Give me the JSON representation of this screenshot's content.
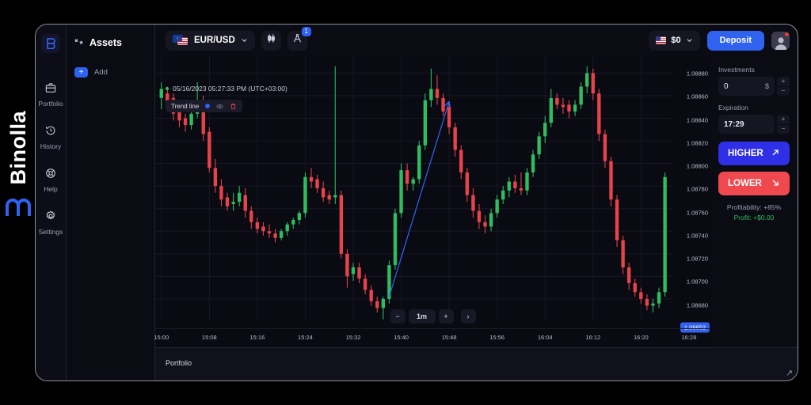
{
  "brand": {
    "name": "Binolla",
    "logo_icon": "binolla-m-logo"
  },
  "rail": {
    "logo_icon": "binolla-b-logo",
    "items": [
      {
        "label": "Portfolio",
        "icon": "briefcase-icon"
      },
      {
        "label": "History",
        "icon": "clock-history-icon"
      },
      {
        "label": "Help",
        "icon": "lifebuoy-icon"
      },
      {
        "label": "Settings",
        "icon": "gear-icon"
      }
    ]
  },
  "assets": {
    "title": "Assets",
    "title_icon": "assets-spark-icon",
    "add_label": "Add",
    "add_icon": "plus-icon"
  },
  "topbar": {
    "pair": "EUR/USD",
    "pair_chevron_icon": "chevron-down-icon",
    "flag_left_icon": "flag-eu-icon",
    "flag_right_icon": "flag-us-icon",
    "chart_type_icon": "candlestick-icon",
    "draw_tools_icon": "drawing-compass-icon",
    "draw_tools_badge": "1",
    "balance_flag_icon": "flag-us-icon",
    "balance": "$0",
    "balance_chevron_icon": "chevron-down-icon",
    "deposit_label": "Deposit",
    "avatar_icon": "user-avatar-icon"
  },
  "chart_info": {
    "timestamp": "05/16/2023 05:27:33 PM (UTC+03:00)",
    "tool_name": "Trend line",
    "tool_color": "#2f62ef",
    "eye_icon": "eye-icon",
    "trash_icon": "trash-icon"
  },
  "timeframe": {
    "minus_label": "−",
    "value": "1m",
    "plus_label": "+",
    "next_icon": "chevron-right-icon"
  },
  "trade": {
    "investments_label": "Investments",
    "investments_value": "0",
    "investments_unit": "$",
    "expiration_label": "Expiration",
    "expiration_value": "17:29",
    "step_up": "+",
    "step_down": "−",
    "higher_label": "HIGHER",
    "higher_icon": "arrow-up-right-icon",
    "lower_label": "LOWER",
    "lower_icon": "arrow-down-right-icon",
    "profitability": "Profitability: +85%",
    "profit": "Profit: +$0.00"
  },
  "bottombar": {
    "label": "Portfolio"
  },
  "colors": {
    "accent_blue": "#2f62ef",
    "higher_blue": "#2f2fe8",
    "lower_red": "#f0484f",
    "candle_up": "#2ebd60",
    "candle_down": "#e8424a",
    "background": "#0a0a12",
    "profit_green": "#2ebd60"
  },
  "chart_data": {
    "type": "candlestick",
    "title": "EUR/USD 1m",
    "xlabel": "",
    "ylabel": "",
    "ylim": [
      1.0866,
      1.08895
    ],
    "yticks": [
      "1.08880",
      "1.08860",
      "1.08840",
      "1.08820",
      "1.08800",
      "1.08780",
      "1.08760",
      "1.08740",
      "1.08720",
      "1.08700",
      "1.08680"
    ],
    "ytick_values": [
      1.0888,
      1.0886,
      1.0884,
      1.0882,
      1.088,
      1.0878,
      1.0876,
      1.0874,
      1.0872,
      1.087,
      1.0868
    ],
    "xticks": [
      "15:00",
      "15:08",
      "15:16",
      "15:24",
      "15:32",
      "15:40",
      "15:48",
      "15:56",
      "16:04",
      "16:12",
      "16:20",
      "16:28"
    ],
    "current_price": "1.08652",
    "grid": true,
    "legend": "none",
    "annotations": [
      {
        "type": "trendline",
        "label": "Trend line",
        "color": "#2f62ef",
        "from": {
          "time": "15:38",
          "price": 1.08682
        },
        "to": {
          "time": "15:48",
          "price": 1.08855
        },
        "arrow": true
      }
    ],
    "candles": [
      {
        "t": "15:00",
        "o": 1.08858,
        "h": 1.08872,
        "l": 1.08848,
        "c": 1.08866
      },
      {
        "t": "15:01",
        "o": 1.08862,
        "h": 1.08868,
        "l": 1.08852,
        "c": 1.08855
      },
      {
        "t": "15:02",
        "o": 1.08858,
        "h": 1.08862,
        "l": 1.08838,
        "c": 1.08844
      },
      {
        "t": "15:03",
        "o": 1.08846,
        "h": 1.0885,
        "l": 1.08832,
        "c": 1.08838
      },
      {
        "t": "15:04",
        "o": 1.0884,
        "h": 1.08844,
        "l": 1.08828,
        "c": 1.08834
      },
      {
        "t": "15:05",
        "o": 1.08834,
        "h": 1.08846,
        "l": 1.0883,
        "c": 1.08844
      },
      {
        "t": "15:06",
        "o": 1.08844,
        "h": 1.08872,
        "l": 1.0884,
        "c": 1.08856
      },
      {
        "t": "15:07",
        "o": 1.08856,
        "h": 1.0886,
        "l": 1.0882,
        "c": 1.08826
      },
      {
        "t": "15:08",
        "o": 1.08828,
        "h": 1.08832,
        "l": 1.08792,
        "c": 1.08796
      },
      {
        "t": "15:09",
        "o": 1.08796,
        "h": 1.08804,
        "l": 1.08774,
        "c": 1.0878
      },
      {
        "t": "15:10",
        "o": 1.0878,
        "h": 1.08786,
        "l": 1.08762,
        "c": 1.08768
      },
      {
        "t": "15:11",
        "o": 1.0877,
        "h": 1.08774,
        "l": 1.08758,
        "c": 1.08762
      },
      {
        "t": "15:12",
        "o": 1.08764,
        "h": 1.08774,
        "l": 1.08758,
        "c": 1.08766
      },
      {
        "t": "15:13",
        "o": 1.08766,
        "h": 1.0878,
        "l": 1.08762,
        "c": 1.08774
      },
      {
        "t": "15:14",
        "o": 1.08772,
        "h": 1.08778,
        "l": 1.08752,
        "c": 1.08758
      },
      {
        "t": "15:15",
        "o": 1.08758,
        "h": 1.08762,
        "l": 1.08742,
        "c": 1.08748
      },
      {
        "t": "15:16",
        "o": 1.08748,
        "h": 1.08752,
        "l": 1.08738,
        "c": 1.08742
      },
      {
        "t": "15:17",
        "o": 1.08744,
        "h": 1.08748,
        "l": 1.08736,
        "c": 1.0874
      },
      {
        "t": "15:18",
        "o": 1.0874,
        "h": 1.08746,
        "l": 1.08734,
        "c": 1.08738
      },
      {
        "t": "15:19",
        "o": 1.08738,
        "h": 1.08742,
        "l": 1.0873,
        "c": 1.08734
      },
      {
        "t": "15:20",
        "o": 1.08734,
        "h": 1.08742,
        "l": 1.08732,
        "c": 1.0874
      },
      {
        "t": "15:21",
        "o": 1.0874,
        "h": 1.08748,
        "l": 1.08736,
        "c": 1.08746
      },
      {
        "t": "15:22",
        "o": 1.08746,
        "h": 1.08752,
        "l": 1.08742,
        "c": 1.0875
      },
      {
        "t": "15:23",
        "o": 1.0875,
        "h": 1.08758,
        "l": 1.08746,
        "c": 1.08756
      },
      {
        "t": "15:24",
        "o": 1.08756,
        "h": 1.08792,
        "l": 1.08752,
        "c": 1.08788
      },
      {
        "t": "15:25",
        "o": 1.08788,
        "h": 1.08796,
        "l": 1.08778,
        "c": 1.08784
      },
      {
        "t": "15:26",
        "o": 1.08786,
        "h": 1.0879,
        "l": 1.08774,
        "c": 1.08778
      },
      {
        "t": "15:27",
        "o": 1.08778,
        "h": 1.08784,
        "l": 1.08766,
        "c": 1.0877
      },
      {
        "t": "15:28",
        "o": 1.08772,
        "h": 1.08776,
        "l": 1.08764,
        "c": 1.08768
      },
      {
        "t": "15:29",
        "o": 1.0877,
        "h": 1.08886,
        "l": 1.08764,
        "c": 1.08772
      },
      {
        "t": "15:30",
        "o": 1.08772,
        "h": 1.08776,
        "l": 1.08716,
        "c": 1.0872
      },
      {
        "t": "15:31",
        "o": 1.0872,
        "h": 1.08724,
        "l": 1.0869,
        "c": 1.087
      },
      {
        "t": "15:32",
        "o": 1.08702,
        "h": 1.08712,
        "l": 1.08696,
        "c": 1.08708
      },
      {
        "t": "15:33",
        "o": 1.08708,
        "h": 1.08712,
        "l": 1.08694,
        "c": 1.08698
      },
      {
        "t": "15:34",
        "o": 1.08698,
        "h": 1.08702,
        "l": 1.08684,
        "c": 1.08688
      },
      {
        "t": "15:35",
        "o": 1.08688,
        "h": 1.08692,
        "l": 1.08674,
        "c": 1.08678
      },
      {
        "t": "15:36",
        "o": 1.08678,
        "h": 1.08682,
        "l": 1.08668,
        "c": 1.08672
      },
      {
        "t": "15:37",
        "o": 1.08672,
        "h": 1.08682,
        "l": 1.08662,
        "c": 1.0868
      },
      {
        "t": "15:38",
        "o": 1.0868,
        "h": 1.08714,
        "l": 1.08676,
        "c": 1.0871
      },
      {
        "t": "15:39",
        "o": 1.0871,
        "h": 1.0876,
        "l": 1.08706,
        "c": 1.08756
      },
      {
        "t": "15:40",
        "o": 1.08756,
        "h": 1.088,
        "l": 1.08752,
        "c": 1.08794
      },
      {
        "t": "15:41",
        "o": 1.08794,
        "h": 1.088,
        "l": 1.08776,
        "c": 1.08782
      },
      {
        "t": "15:42",
        "o": 1.08782,
        "h": 1.08788,
        "l": 1.08776,
        "c": 1.08786
      },
      {
        "t": "15:43",
        "o": 1.08786,
        "h": 1.0882,
        "l": 1.08782,
        "c": 1.08816
      },
      {
        "t": "15:44",
        "o": 1.08816,
        "h": 1.08862,
        "l": 1.08812,
        "c": 1.08856
      },
      {
        "t": "15:45",
        "o": 1.08856,
        "h": 1.08884,
        "l": 1.0885,
        "c": 1.08866
      },
      {
        "t": "15:46",
        "o": 1.08866,
        "h": 1.08878,
        "l": 1.08852,
        "c": 1.08858
      },
      {
        "t": "15:47",
        "o": 1.08858,
        "h": 1.08862,
        "l": 1.08842,
        "c": 1.08846
      },
      {
        "t": "15:48",
        "o": 1.0885,
        "h": 1.08854,
        "l": 1.08826,
        "c": 1.08832
      },
      {
        "t": "15:49",
        "o": 1.08832,
        "h": 1.08836,
        "l": 1.08806,
        "c": 1.08812
      },
      {
        "t": "15:50",
        "o": 1.08812,
        "h": 1.08816,
        "l": 1.08786,
        "c": 1.08792
      },
      {
        "t": "15:51",
        "o": 1.08792,
        "h": 1.08796,
        "l": 1.08766,
        "c": 1.08772
      },
      {
        "t": "15:52",
        "o": 1.08772,
        "h": 1.08778,
        "l": 1.08752,
        "c": 1.08758
      },
      {
        "t": "15:53",
        "o": 1.08758,
        "h": 1.08764,
        "l": 1.08742,
        "c": 1.08748
      },
      {
        "t": "15:54",
        "o": 1.08748,
        "h": 1.08754,
        "l": 1.08738,
        "c": 1.08744
      },
      {
        "t": "15:55",
        "o": 1.08744,
        "h": 1.0876,
        "l": 1.0874,
        "c": 1.08756
      },
      {
        "t": "15:56",
        "o": 1.08756,
        "h": 1.08772,
        "l": 1.08752,
        "c": 1.08768
      },
      {
        "t": "15:57",
        "o": 1.08768,
        "h": 1.0878,
        "l": 1.08764,
        "c": 1.08776
      },
      {
        "t": "15:58",
        "o": 1.08776,
        "h": 1.08788,
        "l": 1.0877,
        "c": 1.08784
      },
      {
        "t": "15:59",
        "o": 1.08784,
        "h": 1.0879,
        "l": 1.08774,
        "c": 1.08778
      },
      {
        "t": "16:00",
        "o": 1.08778,
        "h": 1.08792,
        "l": 1.08772,
        "c": 1.08776
      },
      {
        "t": "16:01",
        "o": 1.08776,
        "h": 1.08796,
        "l": 1.08772,
        "c": 1.08792
      },
      {
        "t": "16:02",
        "o": 1.08792,
        "h": 1.08812,
        "l": 1.08788,
        "c": 1.08808
      },
      {
        "t": "16:03",
        "o": 1.08808,
        "h": 1.08828,
        "l": 1.08804,
        "c": 1.08824
      },
      {
        "t": "16:04",
        "o": 1.08824,
        "h": 1.08842,
        "l": 1.08818,
        "c": 1.08836
      },
      {
        "t": "16:05",
        "o": 1.08836,
        "h": 1.08866,
        "l": 1.08832,
        "c": 1.08858
      },
      {
        "t": "16:06",
        "o": 1.08858,
        "h": 1.08862,
        "l": 1.08848,
        "c": 1.08852
      },
      {
        "t": "16:07",
        "o": 1.08852,
        "h": 1.08858,
        "l": 1.08844,
        "c": 1.0885
      },
      {
        "t": "16:08",
        "o": 1.08852,
        "h": 1.08856,
        "l": 1.0884,
        "c": 1.08846
      },
      {
        "t": "16:09",
        "o": 1.08846,
        "h": 1.08856,
        "l": 1.08842,
        "c": 1.08852
      },
      {
        "t": "16:10",
        "o": 1.08852,
        "h": 1.08872,
        "l": 1.08848,
        "c": 1.08868
      },
      {
        "t": "16:11",
        "o": 1.08868,
        "h": 1.08886,
        "l": 1.08862,
        "c": 1.0888
      },
      {
        "t": "16:12",
        "o": 1.0888,
        "h": 1.08884,
        "l": 1.08856,
        "c": 1.08862
      },
      {
        "t": "16:13",
        "o": 1.08862,
        "h": 1.08866,
        "l": 1.0882,
        "c": 1.08826
      },
      {
        "t": "16:14",
        "o": 1.08826,
        "h": 1.0883,
        "l": 1.08796,
        "c": 1.08802
      },
      {
        "t": "16:15",
        "o": 1.08802,
        "h": 1.08806,
        "l": 1.08762,
        "c": 1.08768
      },
      {
        "t": "16:16",
        "o": 1.08768,
        "h": 1.08772,
        "l": 1.08726,
        "c": 1.08732
      },
      {
        "t": "16:17",
        "o": 1.08732,
        "h": 1.08736,
        "l": 1.08702,
        "c": 1.08708
      },
      {
        "t": "16:18",
        "o": 1.08708,
        "h": 1.08712,
        "l": 1.08688,
        "c": 1.08694
      },
      {
        "t": "16:19",
        "o": 1.08694,
        "h": 1.08698,
        "l": 1.08682,
        "c": 1.08686
      },
      {
        "t": "16:20",
        "o": 1.08686,
        "h": 1.0869,
        "l": 1.08676,
        "c": 1.0868
      },
      {
        "t": "16:21",
        "o": 1.0868,
        "h": 1.08684,
        "l": 1.0867,
        "c": 1.08674
      },
      {
        "t": "16:22",
        "o": 1.08674,
        "h": 1.0868,
        "l": 1.08668,
        "c": 1.08676
      },
      {
        "t": "16:23",
        "o": 1.08676,
        "h": 1.0869,
        "l": 1.08672,
        "c": 1.08686
      },
      {
        "t": "16:24",
        "o": 1.08686,
        "h": 1.08792,
        "l": 1.08682,
        "c": 1.08788
      }
    ]
  }
}
